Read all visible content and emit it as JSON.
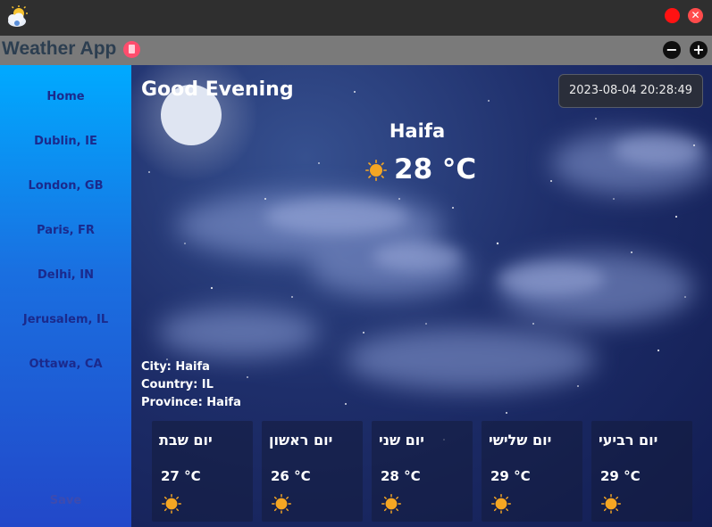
{
  "titlebar": {
    "app_icon": "weather-cloud-sun-icon",
    "minimize_icon": "red-circle-icon",
    "close_icon": "close-icon",
    "close_glyph": "✕"
  },
  "header": {
    "title": "Weather App",
    "badge_icon": "app-badge-icon",
    "zoom_out_glyph": "−",
    "zoom_in_glyph": "+"
  },
  "sidebar": {
    "items": [
      {
        "label": "Home"
      },
      {
        "label": "Dublin, IE"
      },
      {
        "label": "London, GB"
      },
      {
        "label": "Paris, FR"
      },
      {
        "label": "Delhi, IN"
      },
      {
        "label": "Jerusalem, IL"
      },
      {
        "label": "Ottawa, CA"
      }
    ],
    "save_label": "Save"
  },
  "main": {
    "greeting": "Good Evening",
    "datetime": "2023-08-04 20:28:49",
    "city": "Haifa",
    "temperature": "28 °C",
    "weather_icon": "sun-icon",
    "info": {
      "city": "City: Haifa",
      "country": "Country: IL",
      "province": "Province: Haifa"
    },
    "forecast": [
      {
        "day": "יום שבת",
        "temp": "27 °C",
        "icon": "sun-icon"
      },
      {
        "day": "יום ראשון",
        "temp": "26 °C",
        "icon": "sun-icon"
      },
      {
        "day": "יום שני",
        "temp": "28 °C",
        "icon": "sun-icon"
      },
      {
        "day": "יום שלישי",
        "temp": "29 °C",
        "icon": "sun-icon"
      },
      {
        "day": "יום רביעי",
        "temp": "29 °C",
        "icon": "sun-icon"
      }
    ]
  },
  "colors": {
    "sun": "#f5a623",
    "sidebar_top": "#00aaff",
    "sidebar_bottom": "#2248c9",
    "sidebar_text": "#1b2a8c"
  }
}
